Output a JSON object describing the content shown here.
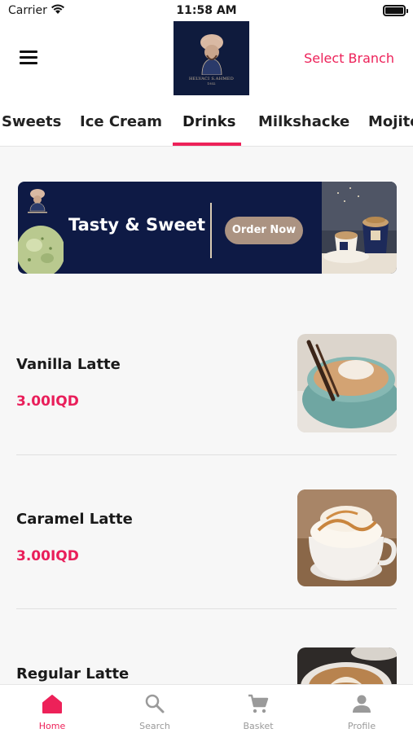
{
  "status_bar": {
    "carrier": "Carrier",
    "time": "11:58 AM"
  },
  "header": {
    "logo_text": "HELVACI S.AHMED",
    "logo_year": "1932",
    "select_branch": "Select Branch"
  },
  "tabs": [
    {
      "label": "Sweets"
    },
    {
      "label": "Ice Cream"
    },
    {
      "label": "Drinks",
      "active": true
    },
    {
      "label": "Milkshacke"
    },
    {
      "label": "Mojito"
    }
  ],
  "banner": {
    "title": "Tasty & Sweet",
    "button": "Order Now"
  },
  "products": [
    {
      "name": "Vanilla Latte",
      "price": "3.00IQD"
    },
    {
      "name": "Caramel Latte",
      "price": "3.00IQD"
    },
    {
      "name": "Regular Latte",
      "price": ""
    }
  ],
  "bottom_nav": [
    {
      "label": "Home",
      "icon": "home-icon",
      "active": true
    },
    {
      "label": "Search",
      "icon": "search-icon"
    },
    {
      "label": "Basket",
      "icon": "cart-icon"
    },
    {
      "label": "Profile",
      "icon": "profile-icon"
    }
  ],
  "colors": {
    "accent": "#ed2159",
    "banner_bg": "#0e1a45",
    "logo_bg": "#0f1b3d"
  }
}
